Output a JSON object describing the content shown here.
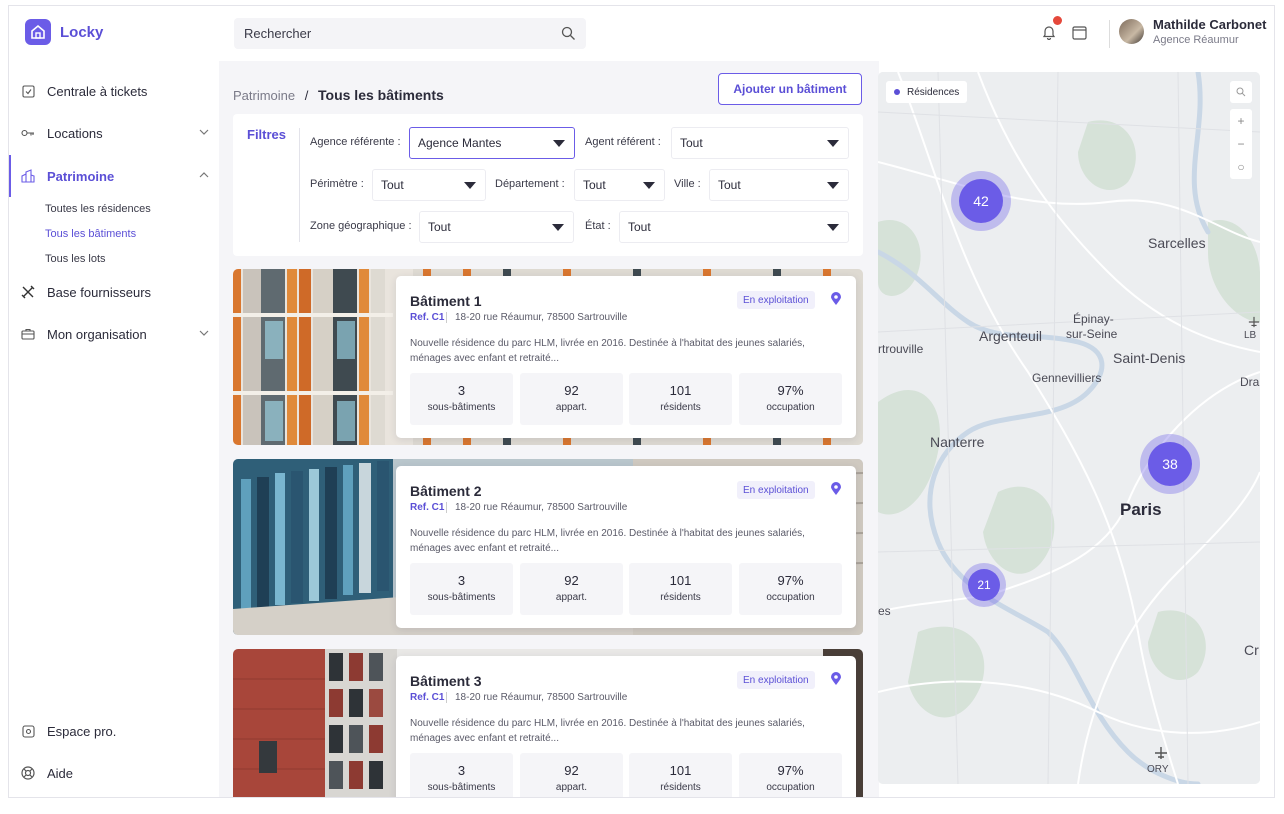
{
  "app": {
    "name": "Locky"
  },
  "search": {
    "placeholder": "Rechercher"
  },
  "user": {
    "name": "Mathilde Carbonet",
    "agency": "Agence Réaumur"
  },
  "sidebar": {
    "items": [
      {
        "label": "Centrale à tickets",
        "icon": "ticket-icon"
      },
      {
        "label": "Locations",
        "icon": "key-icon"
      },
      {
        "label": "Patrimoine",
        "icon": "building-icon"
      },
      {
        "label": "Base fournisseurs",
        "icon": "tools-icon"
      },
      {
        "label": "Mon organisation",
        "icon": "briefcase-icon"
      }
    ],
    "patrimoine_sub": [
      "Toutes les résidences",
      "Tous les bâtiments",
      "Tous les lots"
    ],
    "bottom": [
      {
        "label": "Espace pro.",
        "icon": "pro-icon"
      },
      {
        "label": "Aide",
        "icon": "help-icon"
      }
    ]
  },
  "breadcrumb": {
    "parent": "Patrimoine",
    "separator": "/",
    "current": "Tous les bâtiments"
  },
  "actions": {
    "add_building": "Ajouter un bâtiment"
  },
  "filters": {
    "title": "Filtres",
    "agence_label": "Agence référente :",
    "agence_value": "Agence Mantes",
    "agent_label": "Agent référent :",
    "agent_value": "Tout",
    "perimetre_label": "Périmètre :",
    "perimetre_value": "Tout",
    "departement_label": "Département :",
    "departement_value": "Tout",
    "ville_label": "Ville :",
    "ville_value": "Tout",
    "zone_label": "Zone géographique :",
    "zone_value": "Tout",
    "etat_label": "État :",
    "etat_value": "Tout"
  },
  "buildings": [
    {
      "title": "Bâtiment 1",
      "ref": "Ref. C1",
      "address": "18-20 rue Réaumur, 78500 Sartrouville",
      "status": "En exploitation",
      "description": "Nouvelle résidence du parc HLM, livrée en 2016. Destinée à l'habitat des jeunes salariés, ménages avec enfant et retraité...",
      "stats": [
        {
          "value": "3",
          "label": "sous-bâtiments"
        },
        {
          "value": "92",
          "label": "appart."
        },
        {
          "value": "101",
          "label": "résidents"
        },
        {
          "value": "97%",
          "label": "occupation"
        }
      ]
    },
    {
      "title": "Bâtiment 2",
      "ref": "Ref. C1",
      "address": "18-20 rue Réaumur, 78500 Sartrouville",
      "status": "En exploitation",
      "description": "Nouvelle résidence du parc HLM, livrée en 2016. Destinée à l'habitat des jeunes salariés, ménages avec enfant et retraité...",
      "stats": [
        {
          "value": "3",
          "label": "sous-bâtiments"
        },
        {
          "value": "92",
          "label": "appart."
        },
        {
          "value": "101",
          "label": "résidents"
        },
        {
          "value": "97%",
          "label": "occupation"
        }
      ]
    },
    {
      "title": "Bâtiment 3",
      "ref": "Ref. C1",
      "address": "18-20 rue Réaumur, 78500 Sartrouville",
      "status": "En exploitation",
      "description": "Nouvelle résidence du parc HLM, livrée en 2016. Destinée à l'habitat des jeunes salariés, ménages avec enfant et retraité...",
      "stats": [
        {
          "value": "3",
          "label": "sous-bâtiments"
        },
        {
          "value": "92",
          "label": "appart."
        },
        {
          "value": "101",
          "label": "résidents"
        },
        {
          "value": "97%",
          "label": "occupation"
        }
      ]
    }
  ],
  "map": {
    "legend": "Résidences",
    "clusters": [
      "42",
      "38",
      "21"
    ],
    "places": [
      "Sarcelles",
      "Épinay-",
      "sur-Seine",
      "Argenteuil",
      "Saint-Denis",
      "rtrouville",
      "Gennevilliers",
      "Nanterre",
      "Paris",
      "es",
      "LB",
      "Dra",
      "Cr",
      "ORY"
    ]
  },
  "colors": {
    "accent": "#6b5ce7",
    "notification": "#e5483b"
  }
}
